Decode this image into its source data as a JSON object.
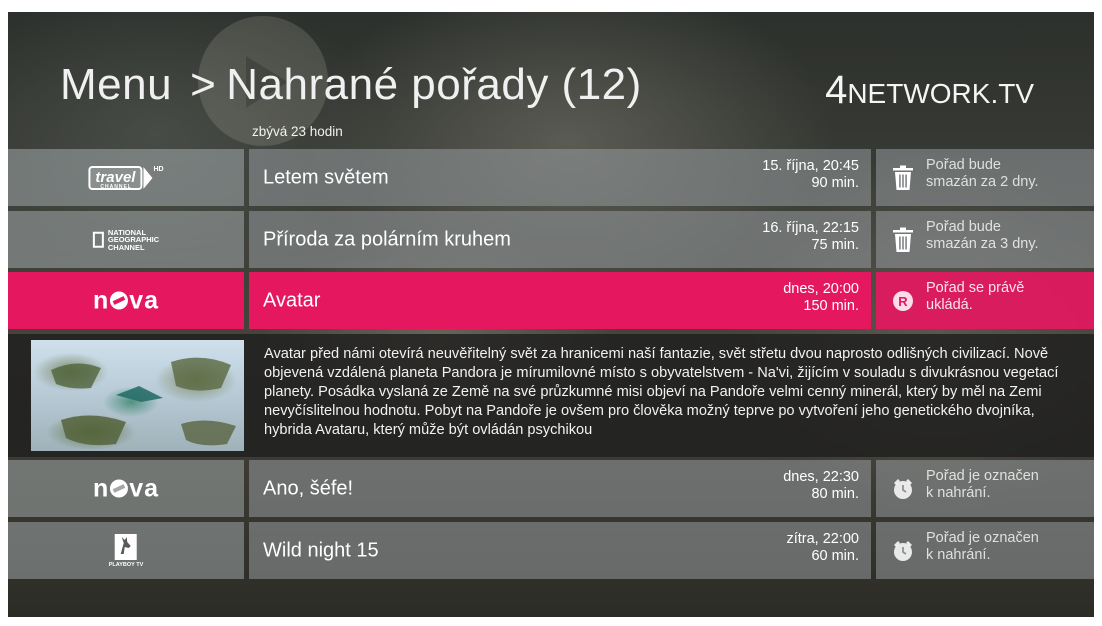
{
  "header": {
    "menu_label": "Menu",
    "chevron": ">",
    "page_title": "Nahrané pořady (12)",
    "remaining": "zbývá 23 hodin"
  },
  "brand": {
    "num": "4",
    "network": "NETWORK",
    "tv": ".TV"
  },
  "colors": {
    "accent": "#e5185f",
    "row_bg": "#96999e",
    "detail_bg": "#1e1e1e"
  },
  "rows": [
    {
      "channel_logo": "travel-channel-hd",
      "logo_text": {
        "main": "travel",
        "sub": "CHANNEL",
        "hd": "HD"
      },
      "title": "Letem světem",
      "date": "15. října, 20:45",
      "duration": "90 min.",
      "status_icon": "trash-icon",
      "status_line1": "Pořad bude",
      "status_line2": "smazán za 2 dny."
    },
    {
      "channel_logo": "national-geographic-channel",
      "logo_text": {
        "line1": "NATIONAL",
        "line2": "GEOGRAPHIC",
        "line3": "CHANNEL"
      },
      "title": "Příroda za polárním kruhem",
      "date": "16. října, 22:15",
      "duration": "75 min.",
      "status_icon": "trash-icon",
      "status_line1": "Pořad bude",
      "status_line2": "smazán za 3 dny."
    },
    {
      "channel_logo": "nova",
      "logo_text": {
        "pre": "n",
        "post": "va"
      },
      "title": "Avatar",
      "date": "dnes, 20:00",
      "duration": "150 min.",
      "status_icon": "recording-icon",
      "status_line1": "Pořad se právě",
      "status_line2": "ukládá.",
      "selected": true
    },
    {
      "channel_logo": "nova",
      "logo_text": {
        "pre": "n",
        "post": "va"
      },
      "title": "Ano, šéfe!",
      "date": "dnes, 22:30",
      "duration": "80 min.",
      "status_icon": "alarm-clock-icon",
      "status_line1": "Pořad je označen",
      "status_line2": "k nahrání."
    },
    {
      "channel_logo": "playboy-tv",
      "logo_text": {
        "label": "PLAYBOY TV"
      },
      "title": "Wild night 15",
      "date": "zítra, 22:00",
      "duration": "60 min.",
      "status_icon": "alarm-clock-icon",
      "status_line1": "Pořad je označen",
      "status_line2": "k nahrání."
    }
  ],
  "detail": {
    "thumbnail": "avatar-thumbnail",
    "description": "Avatar před námi otevírá neuvěřitelný svět za hranicemi naší fantazie, svět střetu dvou naprosto odlišných civilizací. Nově objevená vzdálená planeta Pandora je mírumilovné místo s obyvatelstvem - Na'vi, žijícím v souladu s divukrásnou vegetací planety. Posádka vyslaná ze Země na své průzkumné misi objeví na Pandoře velmi cenný minerál, který by měl na Zemi nevyčíslitelnou hodnotu. Pobyt na Pandoře je ovšem pro člověka možný teprve po vytvoření jeho genetického dvojníka, hybrida Avataru, který může být ovládán psychikou"
  }
}
